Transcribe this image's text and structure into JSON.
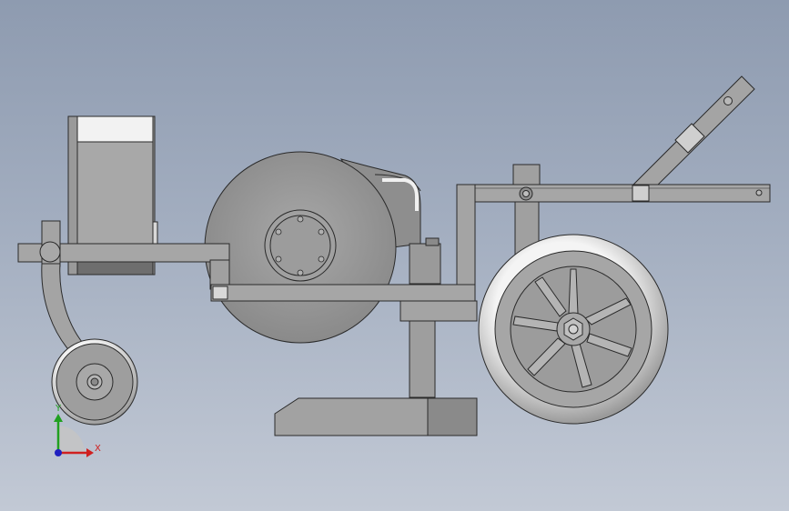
{
  "viewport": {
    "background_top": "#8e9bb0",
    "background_bottom": "#c2c9d5"
  },
  "triad": {
    "x_label": "X",
    "y_label": "Y",
    "x_color": "#d02020",
    "y_color": "#20a020",
    "z_color": "#2020c0"
  },
  "model": {
    "part_color": "#9c9c9c",
    "edge_color": "#2a2a2a",
    "highlight_color": "#f2f2f2"
  }
}
